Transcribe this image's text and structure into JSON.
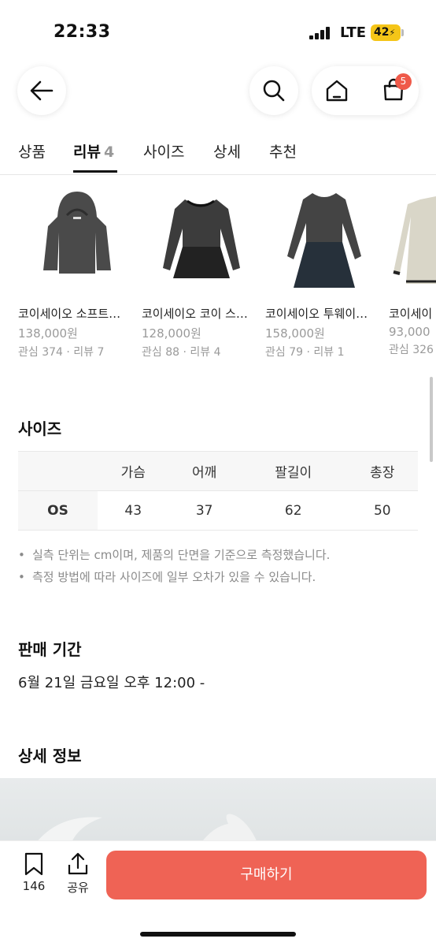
{
  "status_bar": {
    "time": "22:33",
    "network": "LTE",
    "battery": "42"
  },
  "nav": {
    "back_icon": "arrow-left-icon",
    "search_icon": "search-icon",
    "home_icon": "home-icon",
    "cart_icon": "shopping-bag-icon",
    "cart_badge": "5"
  },
  "tabs": [
    {
      "label": "상품"
    },
    {
      "label": "리뷰",
      "count": "4"
    },
    {
      "label": "사이즈"
    },
    {
      "label": "상세"
    },
    {
      "label": "추천"
    }
  ],
  "products": [
    {
      "name": "코이세이오 소프트…",
      "price": "138,000원",
      "meta": "관심 374 · 리뷰 7"
    },
    {
      "name": "코이세이오 코이 스…",
      "price": "128,000원",
      "meta": "관심 88 · 리뷰 4"
    },
    {
      "name": "코이세이오 투웨이…",
      "price": "158,000원",
      "meta": "관심 79 · 리뷰 1"
    },
    {
      "name": "코이세이",
      "price": "93,000",
      "meta": "관심 326"
    }
  ],
  "size_section": {
    "title": "사이즈",
    "headers": [
      "",
      "가슴",
      "어깨",
      "팔길이",
      "총장"
    ],
    "rows": [
      {
        "label": "OS",
        "values": [
          "43",
          "37",
          "62",
          "50"
        ]
      }
    ],
    "notes": [
      "실측 단위는 cm이며, 제품의 단면을 기준으로 측정했습니다.",
      "측정 방법에 따라 사이즈에 일부 오차가 있을 수 있습니다."
    ]
  },
  "sale_period": {
    "title": "판매 기간",
    "value": "6월 21일 금요일 오후 12:00 -"
  },
  "detail_info": {
    "title": "상세 정보"
  },
  "bottom_bar": {
    "like_count": "146",
    "share_label": "공유",
    "buy_label": "구매하기",
    "like_icon": "bookmark-icon",
    "share_icon": "share-icon"
  },
  "colors": {
    "accent": "#ef6355",
    "badge": "#ef5a4a",
    "battery": "#f5c518"
  }
}
